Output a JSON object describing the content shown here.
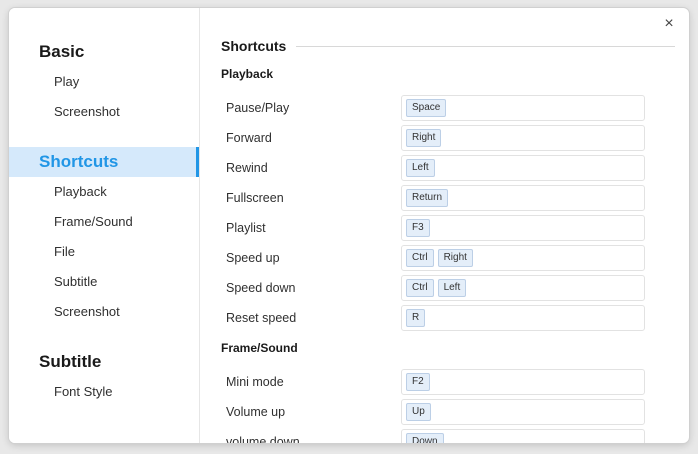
{
  "sidebar": {
    "groups": [
      {
        "title": "Basic",
        "active": false,
        "items": [
          "Play",
          "Screenshot"
        ]
      },
      {
        "title": "Shortcuts",
        "active": true,
        "items": [
          "Playback",
          "Frame/Sound",
          "File",
          "Subtitle",
          "Screenshot"
        ]
      },
      {
        "title": "Subtitle",
        "active": false,
        "items": [
          "Font Style"
        ]
      }
    ]
  },
  "close_icon": "×",
  "content": {
    "section_title": "Shortcuts",
    "groups": [
      {
        "title": "Playback",
        "rows": [
          {
            "label": "Pause/Play",
            "keys": [
              "Space"
            ]
          },
          {
            "label": "Forward",
            "keys": [
              "Right"
            ]
          },
          {
            "label": "Rewind",
            "keys": [
              "Left"
            ]
          },
          {
            "label": "Fullscreen",
            "keys": [
              "Return"
            ]
          },
          {
            "label": "Playlist",
            "keys": [
              "F3"
            ]
          },
          {
            "label": "Speed up",
            "keys": [
              "Ctrl",
              "Right"
            ]
          },
          {
            "label": "Speed down",
            "keys": [
              "Ctrl",
              "Left"
            ]
          },
          {
            "label": "Reset speed",
            "keys": [
              "R"
            ]
          }
        ]
      },
      {
        "title": "Frame/Sound",
        "rows": [
          {
            "label": "Mini mode",
            "keys": [
              "F2"
            ]
          },
          {
            "label": "Volume up",
            "keys": [
              "Up"
            ]
          },
          {
            "label": "volume down",
            "keys": [
              "Down"
            ]
          }
        ]
      }
    ]
  }
}
